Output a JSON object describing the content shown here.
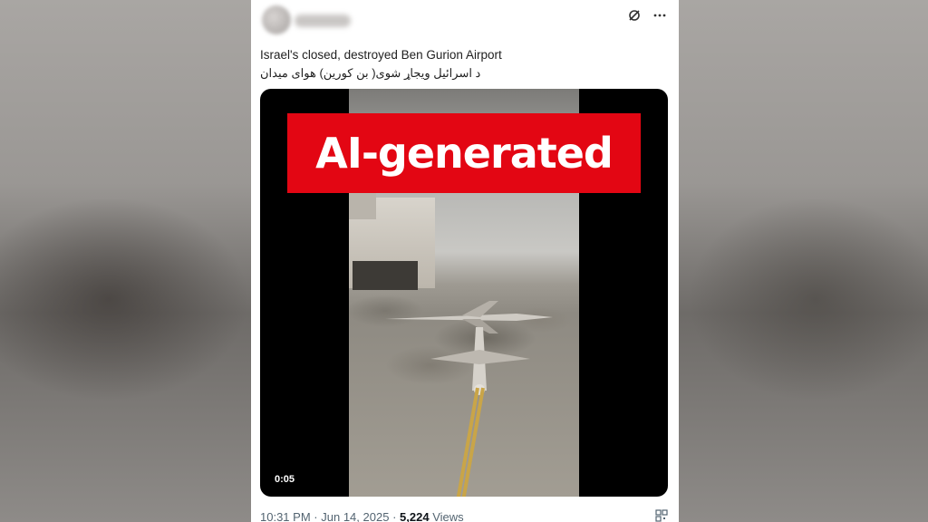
{
  "post": {
    "caption_en": "Israel's closed, destroyed Ben Gurion Airport",
    "caption_ps": "د اسرائیل ویجاړ شوی( بن کورین) هوای میدان",
    "overlay_label": "AI-generated",
    "video_time": "0:05",
    "time": "10:31 PM",
    "date": "Jun 14, 2025",
    "views_count": "5,224",
    "views_label": "Views",
    "separator": "·"
  },
  "icons": {
    "grok": "grok-icon",
    "more": "more-icon",
    "qr": "qr-icon"
  },
  "colors": {
    "label_red": "#e30613",
    "meta_gray": "#536471"
  }
}
